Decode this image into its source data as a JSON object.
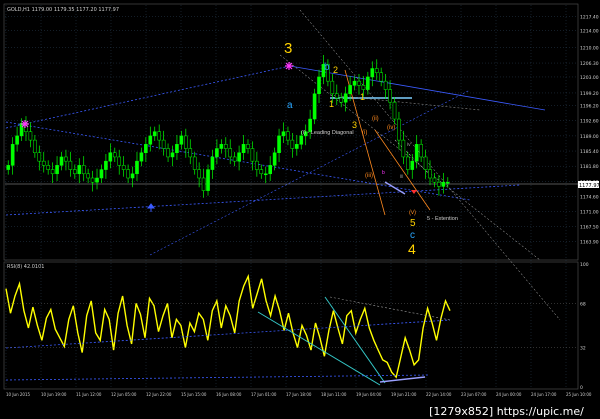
{
  "chart_header": "GOLD,H1 1179.00 1179.35 1177.20 1177.97",
  "rsi_header": "RSI(8) 42.0101",
  "current_price": "1177.97",
  "watermark": "[1279x852] https://upic.me/",
  "colors": {
    "background": "#000000",
    "grid": "#334d66",
    "bull": "#00ff00",
    "bear": "#000000",
    "wick": "#00ff00",
    "rsi": "#ffff00",
    "wave_yellow": "#ffd200",
    "wave_cyan": "#2aa7ff",
    "wave_orange": "#ff8a1f",
    "trend_blue": "#3b5bff",
    "trend_white": "#c8c8c8",
    "magenta": "#ff35ff"
  },
  "chart_data": {
    "type": "candlestick",
    "price_axis": {
      "min": 1160.0,
      "max": 1218.9,
      "ticks": [
        "1217.40",
        "1214.00",
        "1210.00",
        "1206.30",
        "1203.00",
        "1199.20",
        "1196.20",
        "1192.60",
        "1189.00",
        "1185.40",
        "1181.80",
        "1178.20",
        "1174.60",
        "1171.00",
        "1167.50",
        "1163.90"
      ]
    },
    "rsi_axis": {
      "min": 0,
      "max": 100,
      "ticks": [
        "100",
        "68",
        "32",
        "0"
      ]
    },
    "time_ticks": [
      "10 Jun 2015",
      "10 Jun 19:00",
      "11 Jun 12:00",
      "12 Jun 05:00",
      "12 Jun 22:00",
      "15 Jun 15:00",
      "16 Jun 08:00",
      "17 Jun 01:00",
      "17 Jun 18:00",
      "18 Jun 11:00",
      "19 Jun 04:00",
      "19 Jun 21:00",
      "22 Jun 14:00",
      "23 Jun 07:00",
      "24 Jun 00:00",
      "24 Jun 17:00",
      "25 Jun 10:00"
    ],
    "close_path": [
      1182,
      1187,
      1189,
      1192,
      1190,
      1188,
      1185,
      1183,
      1182,
      1181,
      1180,
      1182,
      1184,
      1183,
      1181,
      1180,
      1182,
      1180,
      1179,
      1178,
      1179,
      1181,
      1183,
      1185,
      1184,
      1182,
      1181,
      1179,
      1180,
      1183,
      1185,
      1187,
      1189,
      1190,
      1188,
      1186,
      1184,
      1185,
      1187,
      1189,
      1186,
      1184,
      1181,
      1179,
      1176,
      1181,
      1184,
      1186,
      1187,
      1186,
      1184,
      1183,
      1185,
      1187,
      1186,
      1183,
      1181,
      1180,
      1180,
      1182,
      1185,
      1189,
      1190,
      1188,
      1186,
      1187,
      1189,
      1190,
      1193,
      1199,
      1203,
      1206,
      1202,
      1199,
      1198,
      1197,
      1199,
      1201,
      1202,
      1201,
      1200,
      1203,
      1205,
      1204,
      1202,
      1200,
      1197,
      1193,
      1188,
      1184,
      1181,
      1183,
      1187,
      1184,
      1181,
      1179,
      1178,
      1177,
      1178,
      1178
    ],
    "rsi_path": [
      80,
      60,
      74,
      84,
      62,
      48,
      65,
      50,
      38,
      56,
      63,
      47,
      40,
      33,
      55,
      66,
      44,
      28,
      58,
      70,
      44,
      38,
      63,
      55,
      30,
      60,
      74,
      50,
      35,
      68,
      59,
      40,
      72,
      66,
      45,
      58,
      68,
      40,
      55,
      50,
      32,
      52,
      45,
      60,
      55,
      38,
      62,
      70,
      48,
      66,
      58,
      44,
      70,
      82,
      90,
      64,
      76,
      88,
      70,
      58,
      74,
      62,
      46,
      60,
      44,
      32,
      50,
      42,
      30,
      52,
      40,
      25,
      46,
      62,
      48,
      35,
      58,
      62,
      44,
      55,
      64,
      48,
      38,
      30,
      22,
      20,
      12,
      8,
      24,
      40,
      30,
      18,
      22,
      48,
      64,
      52,
      38,
      56,
      70,
      62
    ]
  },
  "annotations": {
    "wave_3_top": "3",
    "wave_a": "a",
    "wave_b": "b",
    "wave_2": "2",
    "wave_1": "1",
    "wave_3_small": "3",
    "wave_i": "(i)",
    "wave_ii": "(ii)",
    "wave_iii": "(iii)",
    "wave_iv": "(iv)",
    "wave_v": "(v)",
    "wave_5": "5",
    "wave_c": "c",
    "wave_4": "4",
    "wave_sub_iv": "iv",
    "wave_sub_iii": "iii",
    "leading_diagonal": "(i) - Leading Diagonal",
    "extention": "5 - Extention",
    "b_small": "b"
  }
}
